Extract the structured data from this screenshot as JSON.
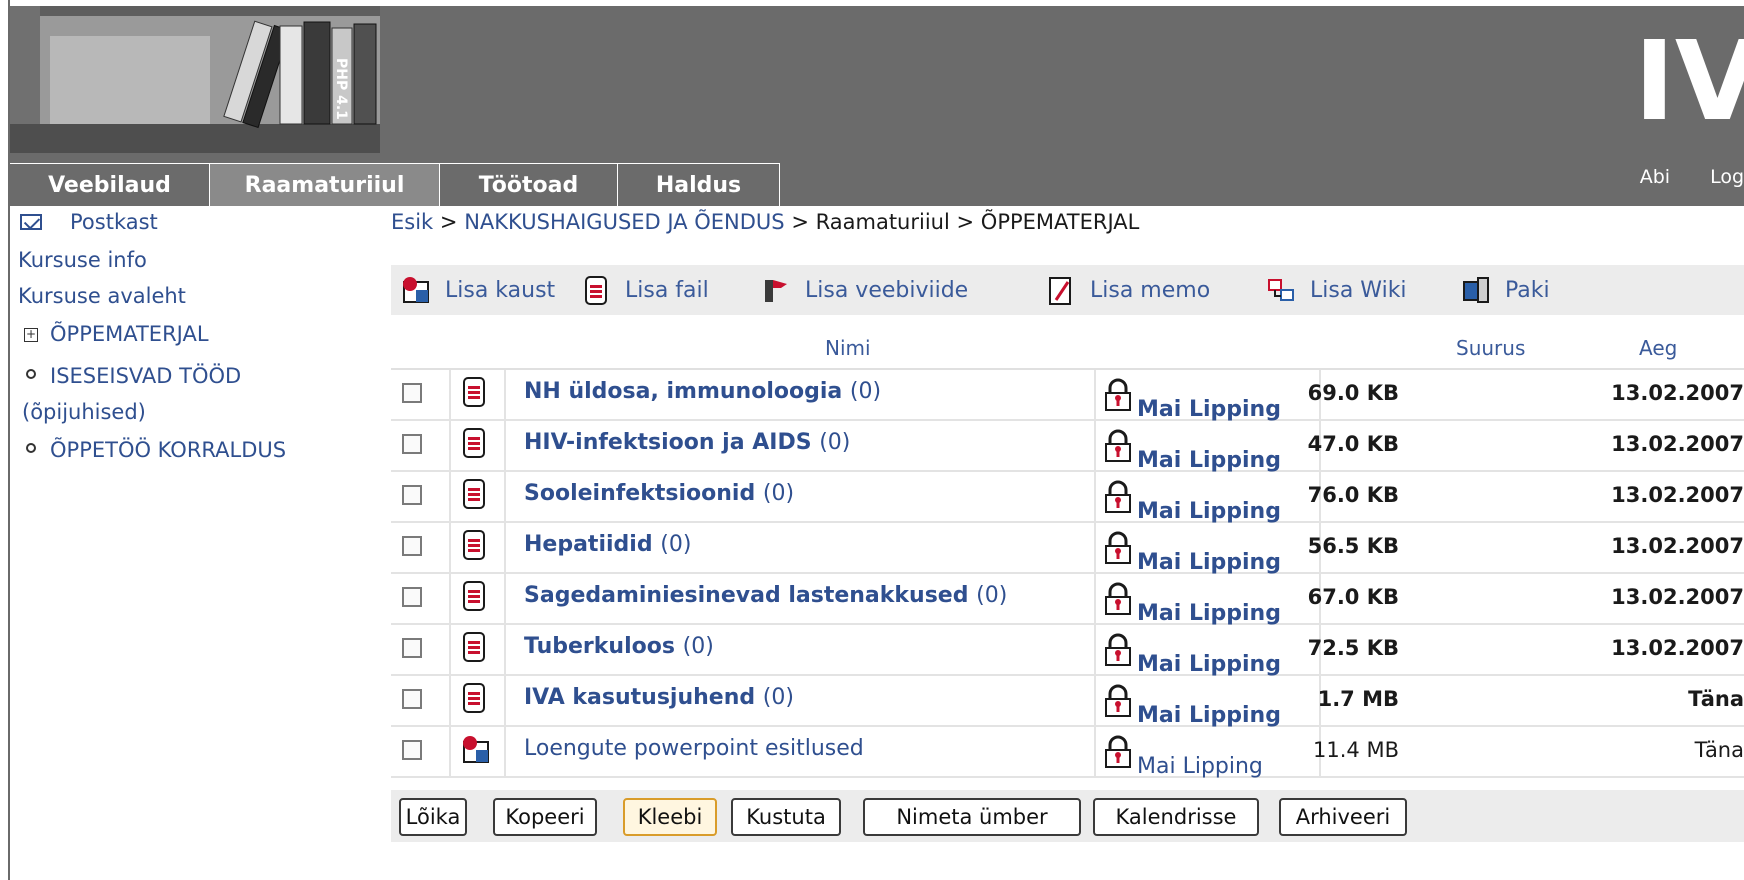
{
  "header": {
    "logo_text": "IV",
    "top_links": [
      "Abi",
      "Log"
    ]
  },
  "tabs": [
    {
      "label": "Veebilaud",
      "active": false
    },
    {
      "label": "Raamaturiiul",
      "active": true
    },
    {
      "label": "Töötoad",
      "active": false
    },
    {
      "label": "Haldus",
      "active": false
    }
  ],
  "sidebar": {
    "mail": "Postkast",
    "course_info": "Kursuse info",
    "course_home": "Kursuse avaleht",
    "tree": [
      {
        "label": "ÕPPEMATERJAL",
        "icon": "plus-box"
      },
      {
        "label": "ISESEISVAD TÖÖD",
        "icon": "bullet"
      },
      {
        "label": "(õpijuhised)",
        "icon": ""
      },
      {
        "label": "ÕPPETÖÖ KORRALDUS",
        "icon": "bullet"
      }
    ]
  },
  "breadcrumb": {
    "home": "Esik",
    "course": "NAKKUSHAIGUSED JA ÕENDUS",
    "section": "Raamaturiiul",
    "current": "ÕPPEMATERJAL",
    "separator": ">"
  },
  "toolbar": {
    "add_folder": "Lisa kaust",
    "add_file": "Lisa fail",
    "add_link": "Lisa veebiviide",
    "add_memo": "Lisa memo",
    "add_wiki": "Lisa Wiki",
    "pack": "Paki"
  },
  "table": {
    "headers": {
      "name": "Nimi",
      "size": "Suurus",
      "time": "Aeg"
    },
    "rows": [
      {
        "name": "NH üldosa, immunoloogia",
        "count": "(0)",
        "owner": "Mai Lipping",
        "size": "69.0 KB",
        "date": "13.02.2007",
        "type": "file"
      },
      {
        "name": "HIV-infektsioon ja AIDS",
        "count": "(0)",
        "owner": "Mai Lipping",
        "size": "47.0 KB",
        "date": "13.02.2007",
        "type": "file"
      },
      {
        "name": "Sooleinfektsioonid",
        "count": "(0)",
        "owner": "Mai Lipping",
        "size": "76.0 KB",
        "date": "13.02.2007",
        "type": "file"
      },
      {
        "name": "Hepatiidid",
        "count": "(0)",
        "owner": "Mai Lipping",
        "size": "56.5 KB",
        "date": "13.02.2007",
        "type": "file"
      },
      {
        "name": "Sagedaminiesinevad lastenakkused",
        "count": "(0)",
        "owner": "Mai Lipping",
        "size": "67.0 KB",
        "date": "13.02.2007",
        "type": "file"
      },
      {
        "name": "Tuberkuloos",
        "count": "(0)",
        "owner": "Mai Lipping",
        "size": "72.5 KB",
        "date": "13.02.2007",
        "type": "file"
      },
      {
        "name": "IVA kasutusjuhend",
        "count": "(0)",
        "owner": "Mai Lipping",
        "size": "1.7 MB",
        "date": "Täna",
        "type": "file"
      },
      {
        "name": "Loengute powerpoint esitlused",
        "count": "",
        "owner": "Mai Lipping",
        "size": "11.4 MB",
        "date": "Täna",
        "type": "folder"
      }
    ]
  },
  "actions": {
    "cut": "Lõika",
    "copy": "Kopeeri",
    "paste": "Kleebi",
    "delete": "Kustuta",
    "rename": "Nimeta ümber",
    "calendar": "Kalendrisse",
    "archive": "Arhiveeri"
  },
  "colors": {
    "header_bg": "#6b6b6b",
    "link": "#2f4f8f",
    "toolbar_bg": "#ececec"
  }
}
